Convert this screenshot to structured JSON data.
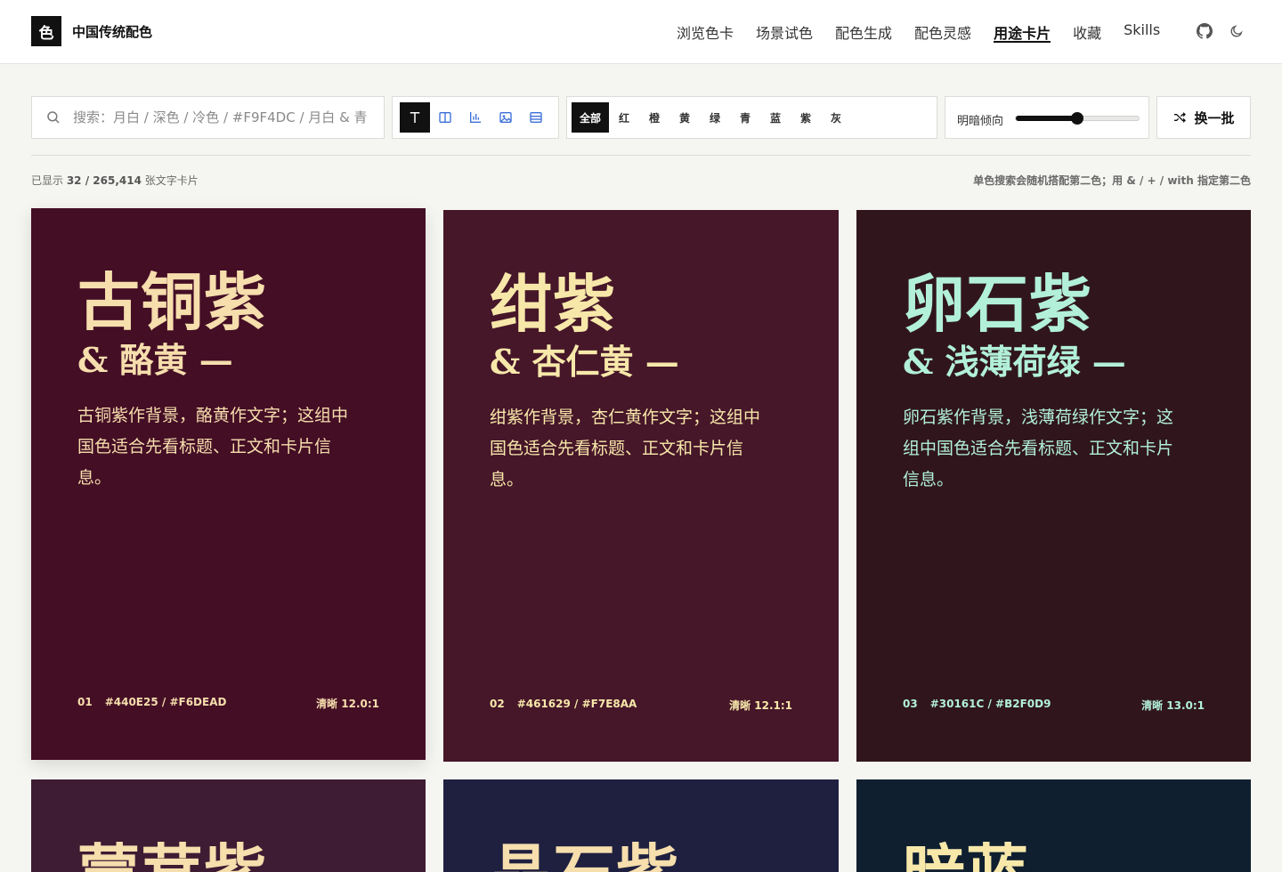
{
  "brand": {
    "logo": "色",
    "name": "中国传统配色"
  },
  "nav": [
    {
      "label": "浏览色卡",
      "active": false
    },
    {
      "label": "场景试色",
      "active": false
    },
    {
      "label": "配色生成",
      "active": false
    },
    {
      "label": "配色灵感",
      "active": false
    },
    {
      "label": "用途卡片",
      "active": true
    },
    {
      "label": "收藏",
      "active": false
    },
    {
      "label": "Skills",
      "active": false
    }
  ],
  "header_icons": [
    "github-icon",
    "moon-icon"
  ],
  "search": {
    "placeholder": "搜索：月白 / 深色 / 冷色 / #F9F4DC / 月白 & 青",
    "value": ""
  },
  "view_modes": [
    {
      "icon": "text-icon",
      "active": true
    },
    {
      "icon": "columns-icon",
      "active": false
    },
    {
      "icon": "bar-chart-icon",
      "active": false
    },
    {
      "icon": "image-icon",
      "active": false
    },
    {
      "icon": "list-icon",
      "active": false
    }
  ],
  "color_filters": [
    "全部",
    "红",
    "橙",
    "黄",
    "绿",
    "青",
    "蓝",
    "紫",
    "灰"
  ],
  "active_filter": "全部",
  "brightness": {
    "label": "明暗倾向",
    "value": 0.5
  },
  "shuffle_label": "换一批",
  "stats": {
    "prefix": "已显示 ",
    "shown": "32",
    "sep": " / ",
    "total": "265,414",
    "suffix": " 张文字卡片"
  },
  "hint": "单色搜索会随机搭配第二色；用 & / + / with 指定第二色",
  "cards": [
    {
      "index": "01",
      "title": "古铜紫",
      "partner": "& 酪黄 —",
      "body": "古铜紫作背景，酪黄作文字；这组中国色适合先看标题、正文和卡片信息。",
      "codes": "#440E25 / #F6DEAD",
      "contrast": "清晰 12.0:1",
      "bg": "#440E25",
      "fg": "#F6DEAD"
    },
    {
      "index": "02",
      "title": "绀紫",
      "partner": "& 杏仁黄 —",
      "body": "绀紫作背景，杏仁黄作文字；这组中国色适合先看标题、正文和卡片信息。",
      "codes": "#461629 / #F7E8AA",
      "contrast": "清晰 12.1:1",
      "bg": "#461629",
      "fg": "#F7E8AA"
    },
    {
      "index": "03",
      "title": "卵石紫",
      "partner": "& 浅薄荷绿 —",
      "body": "卵石紫作背景，浅薄荷绿作文字；这组中国色适合先看标题、正文和卡片信息。",
      "codes": "#30161C / #B2F0D9",
      "contrast": "清晰 13.0:1",
      "bg": "#30161C",
      "fg": "#B2F0D9"
    },
    {
      "title": "蒙茸紫",
      "bg": "#3E1C33",
      "fg": "#F6DEAD"
    },
    {
      "title": "晶石紫",
      "bg": "#1F2040",
      "fg": "#F6DEAD"
    },
    {
      "title": "暗蓝",
      "bg": "#101F30",
      "fg": "#F7E8AA"
    }
  ]
}
